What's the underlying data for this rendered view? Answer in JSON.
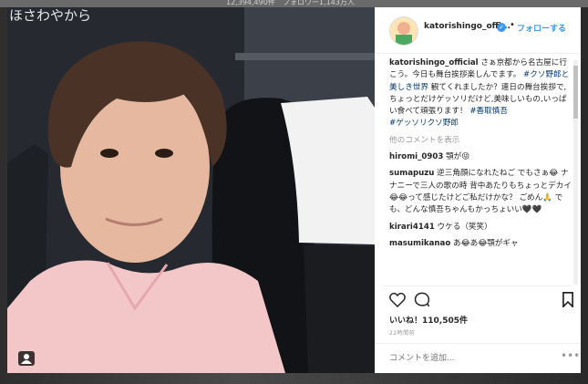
{
  "background": {
    "labels": [
      "12,394,490件",
      "フォロワー1,143万人"
    ]
  },
  "photo": {
    "caption": "ほさわやから"
  },
  "header": {
    "username": "katorishingo_offi...",
    "separator": "•",
    "follow_label": "フォローする"
  },
  "caption": {
    "username": "katorishingo_official",
    "text_1": "さぁ京都から名古屋に行こう。今日も舞台挨拶楽しんでます。",
    "hashtag_1": "#クソ野郎と美しき世界",
    "text_2": "観てくれましたか？連日の舞台挨拶で,ちょっとだけゲッソリだけど,美味しいもの,いっぱい食べて頑張ります！",
    "hashtag_2": "#香取慎吾",
    "hashtag_3": "#ゲッソリクソ野郎"
  },
  "load_more": "他のコメントを表示",
  "comments": [
    {
      "user": "hiromi_0903",
      "text": "顎が😝"
    },
    {
      "user": "sumapuzu",
      "text": "逆三角顔になれたねご でもさぁ😂 ナナニーで三人の歌の時 背中あたりもちょっとデカイ😂😂って感じたけどご私だけかな？ ごめん🙏 でも、どんな慎吾ちゃんもかっちょいい🖤🖤"
    },
    {
      "user": "kirari4141",
      "text": "ウケる（笑笑）"
    },
    {
      "user": "masumikanao",
      "text": "あ😂あ😂顎がギャ"
    }
  ],
  "actions": {
    "like_icon": "heart-icon",
    "comment_icon": "comment-icon",
    "save_icon": "bookmark-icon"
  },
  "likes": "いいね！110,505件",
  "timestamp": "22時間前",
  "add_comment_placeholder": "コメントを追加...",
  "more_options": "•••",
  "colors": {
    "link": "#003569",
    "follow": "#3897f0",
    "verified": "#3897f0"
  }
}
